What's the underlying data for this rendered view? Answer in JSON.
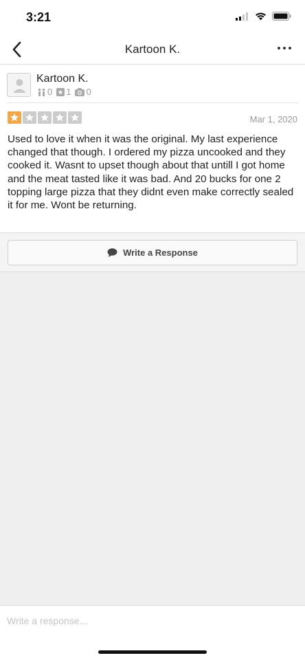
{
  "status_bar": {
    "time": "3:21"
  },
  "nav": {
    "title": "Kartoon K."
  },
  "review": {
    "author": {
      "name": "Kartoon K.",
      "friends": "0",
      "reviews": "1",
      "photos": "0"
    },
    "rating": 1,
    "rating_max": 5,
    "date": "Mar 1, 2020",
    "text": "Used to love it when it was the original. My last experience changed that though. I ordered my pizza uncooked and they cooked it. Wasnt to upset though about that untill I got home and the meat tasted like it was bad. And 20 bucks for one 2 topping large pizza that they didnt even make correctly sealed it for me. Wont be returning."
  },
  "actions": {
    "write_response_label": "Write a Response"
  },
  "compose": {
    "placeholder": "Write a response..."
  },
  "colors": {
    "star_on": "#f0a84b",
    "star_off": "#cccccc"
  },
  "icons": {
    "back": "chevron-left-icon",
    "more": "more-horizontal-icon",
    "friends": "friends-icon",
    "reviews": "reviews-icon",
    "photos": "camera-icon",
    "comment": "speech-bubble-icon"
  }
}
